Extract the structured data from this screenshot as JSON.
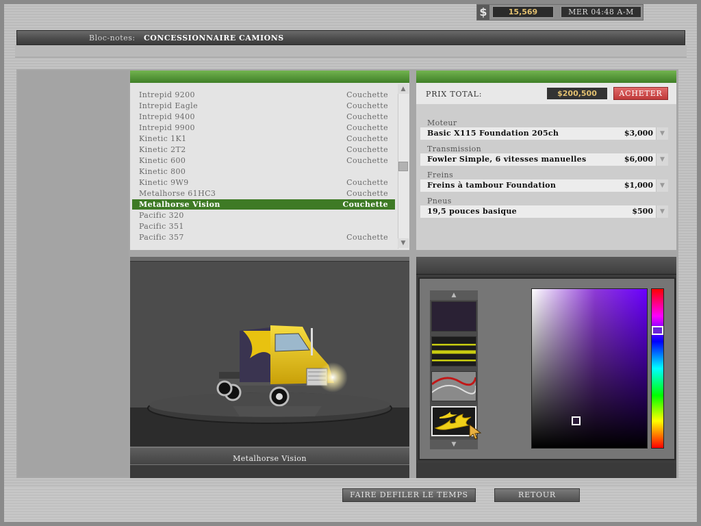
{
  "status": {
    "currency_symbol": "$",
    "money": "15,569",
    "clock": "MER 04:48 A-M"
  },
  "notepad": {
    "label": "Bloc-notes:",
    "title": "CONCESSIONNAIRE CAMIONS"
  },
  "truck_list": {
    "items": [
      {
        "name": "Intrepid 9200",
        "type": "Couchette"
      },
      {
        "name": "Intrepid Eagle",
        "type": "Couchette"
      },
      {
        "name": "Intrepid 9400",
        "type": "Couchette"
      },
      {
        "name": "Intrepid 9900",
        "type": "Couchette"
      },
      {
        "name": "Kinetic 1K1",
        "type": "Couchette"
      },
      {
        "name": "Kinetic 2T2",
        "type": "Couchette"
      },
      {
        "name": "Kinetic 600",
        "type": "Couchette"
      },
      {
        "name": "Kinetic 800",
        "type": ""
      },
      {
        "name": "Kinetic 9W9",
        "type": "Couchette"
      },
      {
        "name": "Metalhorse 61HC3",
        "type": "Couchette"
      },
      {
        "name": "Metalhorse Vision",
        "type": "Couchette"
      },
      {
        "name": "Pacific 320",
        "type": ""
      },
      {
        "name": "Pacific 351",
        "type": ""
      },
      {
        "name": "Pacific 357",
        "type": "Couchette"
      }
    ],
    "selected_index": 10,
    "scroll_up_icon": "triangle-up-icon",
    "scroll_down_icon": "triangle-down-icon"
  },
  "pricing": {
    "total_label": "PRIX TOTAL:",
    "total_value": "$200,500",
    "buy_label": "ACHETER",
    "components": [
      {
        "category": "Moteur",
        "name": "Basic X115 Foundation 205ch",
        "price": "$3,000"
      },
      {
        "category": "Transmission",
        "name": "Fowler Simple, 6 vitesses manuelles",
        "price": "$6,000"
      },
      {
        "category": "Freins",
        "name": "Freins à tambour Foundation",
        "price": "$1,000"
      },
      {
        "category": "Pneus",
        "name": "19,5 pouces basique",
        "price": "$500"
      }
    ]
  },
  "preview": {
    "truck_name": "Metalhorse Vision",
    "colors": {
      "cab": "#e8c210",
      "body": "#3a3450"
    }
  },
  "paint": {
    "selected_swatch_index": 3,
    "hue_color": "#6a22d8"
  },
  "footer": {
    "scroll_time_label": "FAIRE DEFILER LE TEMPS",
    "back_label": "RETOUR"
  }
}
